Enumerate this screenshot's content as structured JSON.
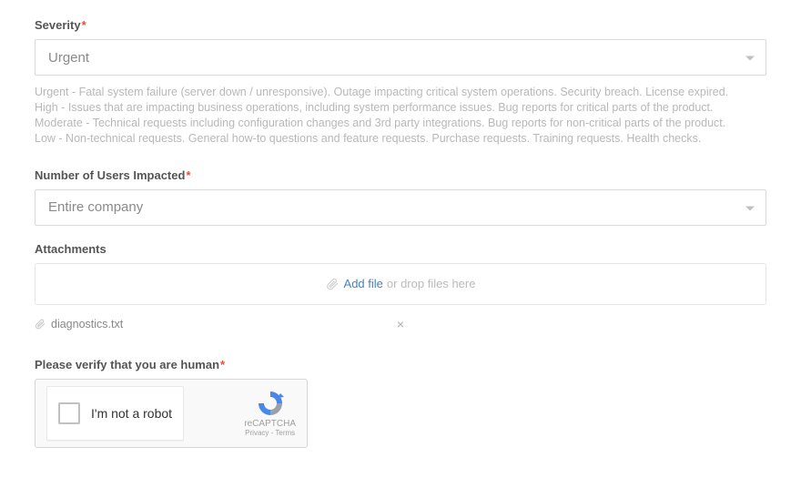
{
  "severity": {
    "label": "Severity",
    "required_mark": "*",
    "value": "Urgent",
    "help": {
      "urgent": "Urgent - Fatal system failure (server down / unresponsive). Outage impacting critical system operations. Security breach. License expired.",
      "high": "High - Issues that are impacting business operations, including system performance issues. Bug reports for critical parts of the product.",
      "moderate": "Moderate - Technical requests including configuration changes and 3rd party integrations. Bug reports for non-critical parts of the product.",
      "low": "Low - Non-technical requests. General how-to questions and feature requests. Purchase requests. Training requests. Health checks."
    }
  },
  "users_impacted": {
    "label": "Number of Users Impacted",
    "required_mark": "*",
    "value": "Entire company"
  },
  "attachments": {
    "label": "Attachments",
    "add_link": "Add file",
    "drop_text": "or drop files here",
    "files": [
      {
        "name": "diagnostics.txt"
      }
    ],
    "remove_glyph": "×"
  },
  "captcha": {
    "label": "Please verify that you are human",
    "required_mark": "*",
    "checkbox_label": "I'm not a robot",
    "brand": "reCAPTCHA",
    "terms": "Privacy - Terms"
  }
}
